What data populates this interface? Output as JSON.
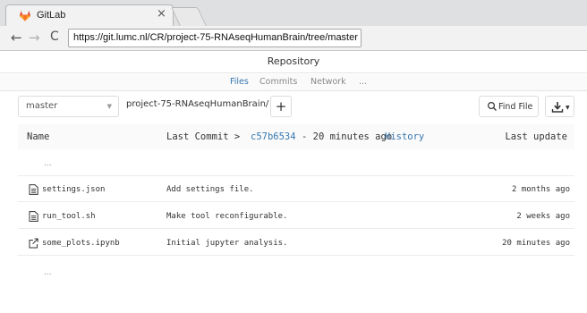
{
  "browser": {
    "tab_title": "GitLab",
    "tab_close": "×",
    "url": "https://git.lumc.nl/CR/project-75-RNAseqHumanBrain/tree/master",
    "back": "←",
    "forward": "→",
    "reload": "C"
  },
  "page": {
    "title": "Repository",
    "subnav": [
      "Files",
      "Commits",
      "Network",
      "..."
    ],
    "branch": "master",
    "breadcrumb": "project-75-RNAseqHumanBrain/",
    "add_label": "+",
    "find_file_label": "Find File"
  },
  "table": {
    "col_name": "Name",
    "last_commit_prefix": "Last Commit >",
    "last_commit_sha": "c57b6534",
    "last_commit_age": "- 20 minutes ago",
    "history": "History",
    "col_update": "Last update",
    "parent_dots": "...",
    "rows": [
      {
        "icon": "file-text-icon",
        "name": "settings.json",
        "message": "Add settings file.",
        "updated": "2 months ago"
      },
      {
        "icon": "file-text-icon",
        "name": "run_tool.sh",
        "message": "Make tool reconfigurable.",
        "updated": "2 weeks ago"
      },
      {
        "icon": "external-link-icon",
        "name": "some_plots.ipynb",
        "message": "Initial jupyter analysis.",
        "updated": "20 minutes ago"
      }
    ],
    "bottom_dots": "..."
  },
  "colors": {
    "link": "#3777b0",
    "gitlab_orange": "#e24329"
  }
}
